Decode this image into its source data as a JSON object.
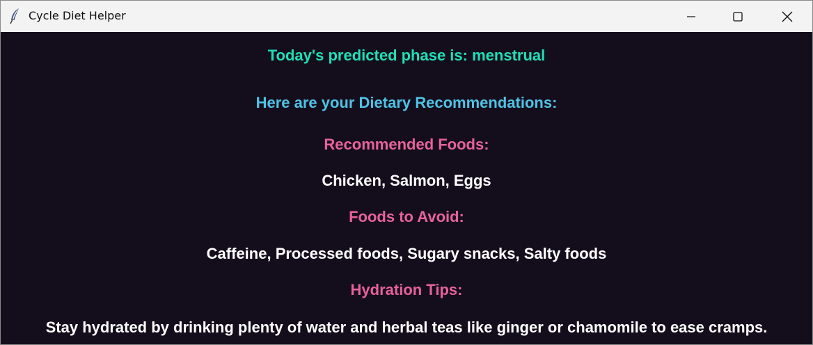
{
  "window": {
    "title": "Cycle Diet Helper",
    "icon": "feather-icon",
    "controls": {
      "minimize_icon": "minimize-icon",
      "maximize_icon": "maximize-icon",
      "close_icon": "close-icon"
    }
  },
  "content": {
    "phase_text": "Today's predicted phase is: menstrual",
    "intro_text": "Here are your Dietary Recommendations:",
    "recommended_heading": "Recommended Foods:",
    "recommended_items": "Chicken, Salmon, Eggs",
    "avoid_heading": "Foods to Avoid:",
    "avoid_items": "Caffeine, Processed foods, Sugary snacks, Salty foods",
    "hydration_heading": "Hydration Tips:",
    "hydration_tip": "Stay hydrated by drinking plenty of water and herbal teas like ginger or chamomile to ease cramps."
  },
  "colors": {
    "background": "#140e1c",
    "phase": "#1ee0b8",
    "intro": "#4fc3e6",
    "heading": "#e8629a",
    "body_text": "#ffffff",
    "titlebar": "#f3f3f3"
  }
}
